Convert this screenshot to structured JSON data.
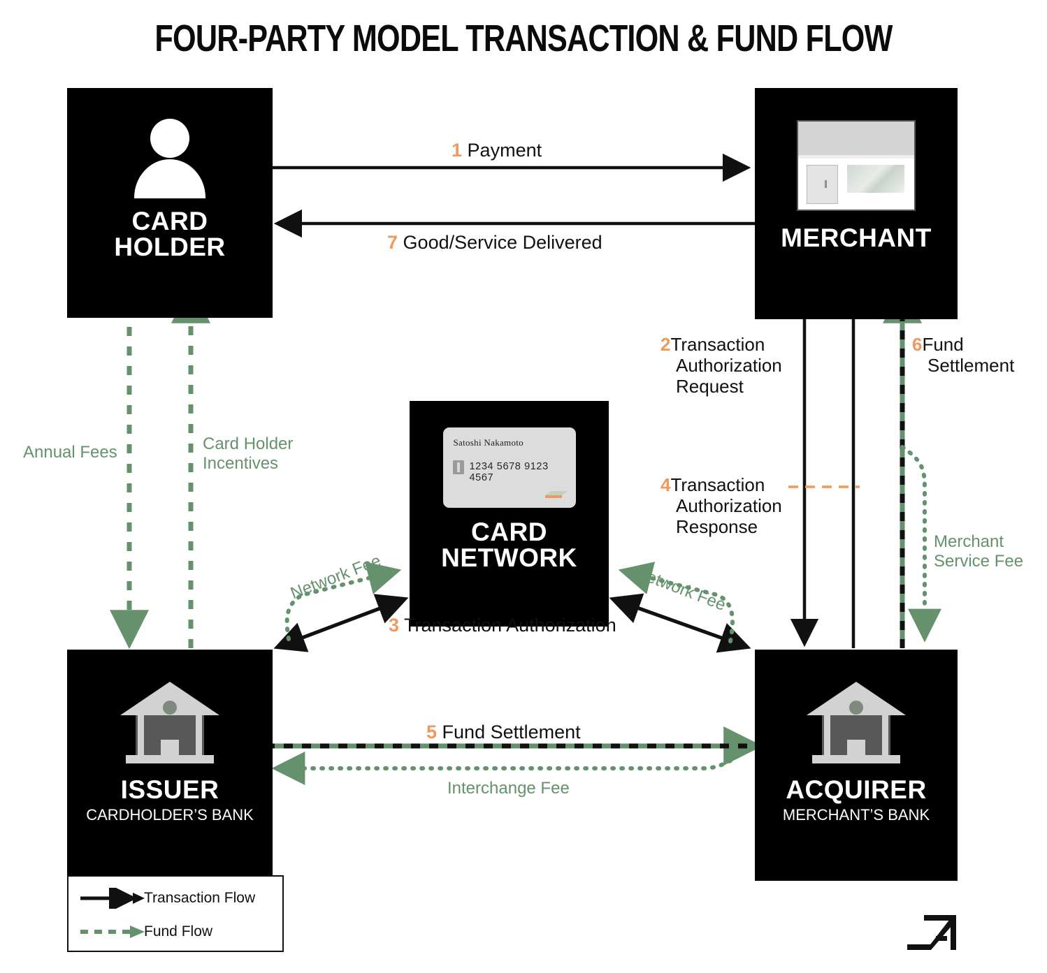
{
  "title": "FOUR-PARTY MODEL TRANSACTION & FUND FLOW",
  "colors": {
    "node_bg": "#000000",
    "accent_orange": "#f0995f",
    "fund_green": "#65926d",
    "transaction_black": "#111111"
  },
  "nodes": {
    "cardholder": {
      "title_line1": "CARD",
      "title_line2": "HOLDER",
      "icon": "person-icon"
    },
    "merchant": {
      "title_line1": "MERCHANT",
      "title_line2": "",
      "icon": "storefront-icon"
    },
    "card_network": {
      "title_line1": "CARD",
      "title_line2": "NETWORK",
      "icon": "credit-card-icon"
    },
    "issuer": {
      "title_line1": "ISSUER",
      "subtitle": "CARDHOLDER’S BANK",
      "icon": "bank-icon"
    },
    "acquirer": {
      "title_line1": "ACQUIRER",
      "subtitle": "MERCHANT’S BANK",
      "icon": "bank-icon"
    }
  },
  "credit_card": {
    "holder_name": "Satoshi Nakamoto",
    "number": "1234 5678 9123 4567",
    "chip": "chip-icon",
    "brand_mark": "brand-logo-icon"
  },
  "transaction_steps": [
    {
      "num": "1",
      "label": "Payment"
    },
    {
      "num": "2",
      "label": "Transaction\nAuthorization\nRequest",
      "lines": [
        "Transaction",
        "Authorization",
        "Request"
      ]
    },
    {
      "num": "3",
      "label": "Transaction Authorization"
    },
    {
      "num": "4",
      "label": "Transaction\nAuthorization\nResponse",
      "lines": [
        "Transaction",
        "Authorization",
        "Response"
      ]
    },
    {
      "num": "5",
      "label": "Fund Settlement"
    },
    {
      "num": "6",
      "label": "Fund\nSettlement",
      "lines": [
        "Fund",
        "Settlement"
      ]
    },
    {
      "num": "7",
      "label": "Good/Service Delivered"
    }
  ],
  "step_text": {
    "s1": "Payment",
    "s2_l1": "Transaction",
    "s2_l2": "Authorization",
    "s2_l3": "Request",
    "s3": "Transaction Authorization",
    "s4_l1": "Transaction",
    "s4_l2": "Authorization",
    "s4_l3": "Response",
    "s5": "Fund Settlement",
    "s6_l1": "Fund",
    "s6_l2": "Settlement",
    "s7": "Good/Service Delivered"
  },
  "step_nums": {
    "n1": "1",
    "n2": "2",
    "n3": "3",
    "n4": "4",
    "n5": "5",
    "n6": "6",
    "n7": "7"
  },
  "fund_flow_labels": {
    "annual_fees": "Annual Fees",
    "cardholder_incentives_l1": "Card Holder",
    "cardholder_incentives_l2": "Incentives",
    "network_fee_left": "Network Fee",
    "network_fee_right": "Network Fee",
    "merchant_service_fee_l1": "Merchant",
    "merchant_service_fee_l2": "Service Fee",
    "interchange_fee": "Interchange Fee"
  },
  "legend": {
    "transaction_flow": "Transaction Flow",
    "fund_flow": "Fund Flow"
  },
  "corner_logo": "arrow-a-logo"
}
